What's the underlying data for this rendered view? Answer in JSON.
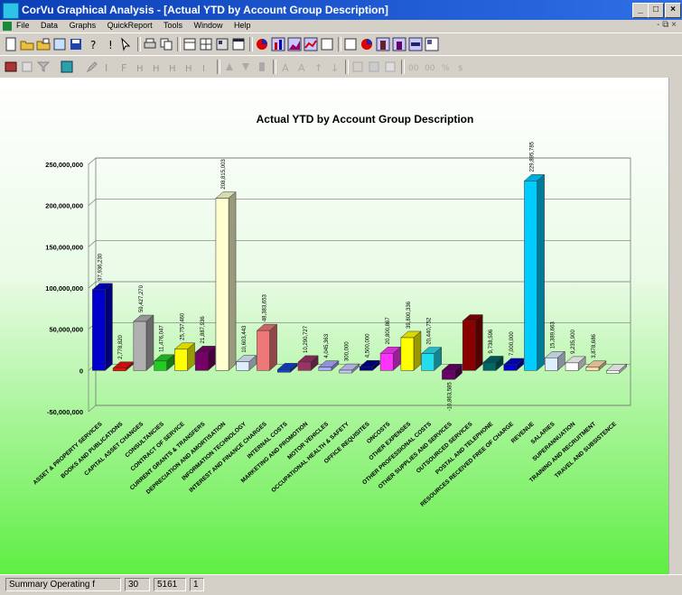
{
  "window": {
    "title": "CorVu Graphical Analysis - [Actual YTD by Account Group Description]"
  },
  "menu": {
    "items": [
      "File",
      "Data",
      "Graphs",
      "QuickReport",
      "Tools",
      "Window",
      "Help"
    ],
    "mdi_controls": "- ⧉ ×"
  },
  "status": {
    "panel1": "Summary Operating f",
    "panel2": "30",
    "panel3": "5161",
    "panel4": "1"
  },
  "chart_data": {
    "type": "bar",
    "title": "Actual YTD by Account Group Description",
    "xlabel": "",
    "ylabel": "",
    "ylim": [
      -50000000,
      250000000
    ],
    "yticks": [
      -50000000,
      0,
      50000000,
      100000000,
      150000000,
      200000000,
      250000000
    ],
    "ytick_labels": [
      "-50,000,000",
      "0",
      "50,000,000",
      "100,000,000",
      "150,000,000",
      "200,000,000",
      "250,000,000"
    ],
    "grid": true,
    "categories": [
      "ASSET & PROPERTY SERVICES",
      "BOOKS AND PUBLICATIONS",
      "CAPITAL ASSET CHANGES",
      "CONSULTANCIES",
      "CONTRACT OF SERVICE",
      "CURRENT GRANTS & TRANSFERS",
      "DEPRECIATION AND AMORTISATION",
      "INFORMATION TECHNOLOGY",
      "INTEREST AND FINANCE CHARGES",
      "INTERNAL COSTS",
      "MARKETING AND PROMOTION",
      "MOTOR VEHICLES",
      "OCCUPATIONAL HEALTH & SAFETY",
      "OFFICE REQUISITES",
      "ONCOSTS",
      "OTHER EXPENSES",
      "OTHER PROFESSIONAL COSTS",
      "OTHER SUPPLIES AND SERVICES",
      "OUTSOURCED SERVICES",
      "POSTAL AND TELEPHONE",
      "RESOURCES RECEIVED FREE OF CHARGE",
      "REVENUE",
      "SALARIES",
      "SUPERANNUATION",
      "TRAINING AND RECRUITMENT",
      "TRAVEL AND SUBSISTENCE"
    ],
    "values": [
      97936230,
      2778820,
      59427270,
      11476047,
      25757460,
      21887936,
      208815003,
      10603443,
      48383653,
      1093445,
      10290727,
      4045363,
      300000,
      4500000,
      20800867,
      39800336,
      20440752,
      -10863585,
      60000000,
      9738596,
      7000000,
      229895785,
      15389663,
      9235900,
      3878686,
      0
    ],
    "value_labels": [
      "97,936,230",
      "2,778,820",
      "59,427,270",
      "11,476,047",
      "25,757,460",
      "21,887,936",
      "208,815,003",
      "10,603,443",
      "48,383,653",
      "",
      "10,290,727",
      "4,045,363",
      "300,000",
      "4,500,000",
      "20,800,867",
      "39,800,336",
      "20,440,752",
      "-10,863,585",
      "",
      "9,738,596",
      "7,000,000",
      "229,895,785",
      "15,389,663",
      "9,235,900",
      "3,878,686",
      ""
    ],
    "colors": [
      "#0000cc",
      "#ee1111",
      "#b0b0b0",
      "#22cc22",
      "#ffff00",
      "#770066",
      "#ffffd0",
      "#ddeeff",
      "#ee7777",
      "#1144cc",
      "#993366",
      "#aaaaff",
      "#ccccff",
      "#000088",
      "#ff33ff",
      "#ffff00",
      "#22ddee",
      "#660066",
      "#880000",
      "#006666",
      "#0000cc",
      "#00ccff",
      "#ddeeff",
      "#ffffff",
      "#ffddaa",
      "#ffffff"
    ]
  }
}
